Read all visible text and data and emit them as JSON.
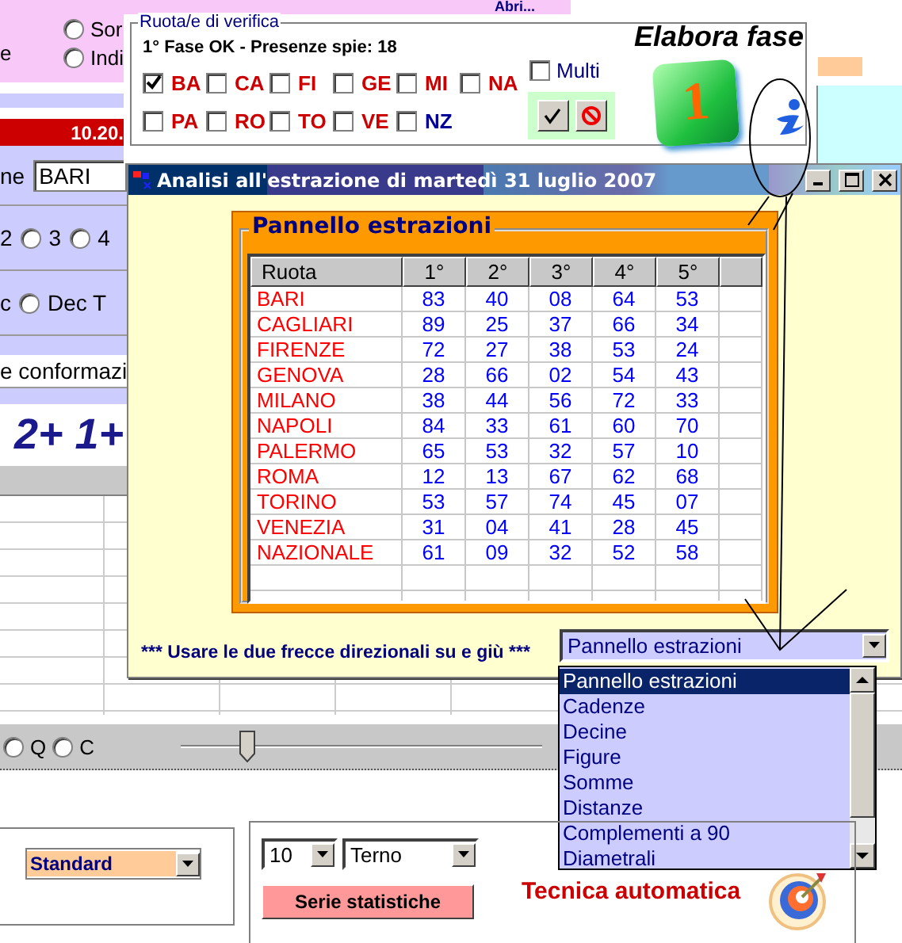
{
  "background_app": {
    "link_text": "Abri...",
    "side_label": "e",
    "top_radios": [
      {
        "label": "Sor",
        "selected": false
      },
      {
        "label": "Indi",
        "selected": false
      }
    ],
    "time_label": "10.20.",
    "wheel_label": "ne",
    "wheel_value": "BARI",
    "count_prefix": "2",
    "count_radios": [
      {
        "label": "3",
        "selected": false
      },
      {
        "label": "4",
        "selected": false
      }
    ],
    "dec_label": "c",
    "dec_radios": [
      {
        "label": "Dec T",
        "selected": false
      }
    ],
    "conformation_text": "e conformazi",
    "formula": "2+ 1+",
    "filter_radios": [
      {
        "label": "Q",
        "selected": false
      },
      {
        "label": "C",
        "selected": false
      }
    ],
    "slider": {
      "level": 0.17
    },
    "mode_select": "Standard"
  },
  "verifica": {
    "legend": "Ruota/e di verifica",
    "status": "1° Fase OK - Presenze spie: 18",
    "title": "Elabora fase",
    "phase_number": "1",
    "wheels": [
      {
        "label": "BA",
        "checked": true,
        "color": "#cc0000"
      },
      {
        "label": "CA",
        "checked": false,
        "color": "#cc0000"
      },
      {
        "label": "FI",
        "checked": false,
        "color": "#cc0000"
      },
      {
        "label": "GE",
        "checked": false,
        "color": "#cc0000"
      },
      {
        "label": "MI",
        "checked": false,
        "color": "#cc0000"
      },
      {
        "label": "NA",
        "checked": false,
        "color": "#cc0000"
      },
      {
        "label": "PA",
        "checked": false,
        "color": "#cc0000"
      },
      {
        "label": "RO",
        "checked": false,
        "color": "#cc0000"
      },
      {
        "label": "TO",
        "checked": false,
        "color": "#cc0000"
      },
      {
        "label": "VE",
        "checked": false,
        "color": "#cc0000"
      },
      {
        "label": "NZ",
        "checked": false,
        "color": "#000099"
      }
    ],
    "multi": {
      "label": "Multi",
      "checked": false
    }
  },
  "window": {
    "title": "Analisi all'estrazione di martedì 31 luglio 2007",
    "panel_title": "Pannello estrazioni",
    "table": {
      "columns": [
        "Ruota",
        "1°",
        "2°",
        "3°",
        "4°",
        "5°"
      ],
      "rows": [
        {
          "ruota": "BARI",
          "numbers": [
            "83",
            "40",
            "08",
            "64",
            "53"
          ]
        },
        {
          "ruota": "CAGLIARI",
          "numbers": [
            "89",
            "25",
            "37",
            "66",
            "34"
          ]
        },
        {
          "ruota": "FIRENZE",
          "numbers": [
            "72",
            "27",
            "38",
            "53",
            "24"
          ]
        },
        {
          "ruota": "GENOVA",
          "numbers": [
            "28",
            "66",
            "02",
            "54",
            "43"
          ]
        },
        {
          "ruota": "MILANO",
          "numbers": [
            "38",
            "44",
            "56",
            "72",
            "33"
          ]
        },
        {
          "ruota": "NAPOLI",
          "numbers": [
            "84",
            "33",
            "61",
            "60",
            "70"
          ]
        },
        {
          "ruota": "PALERMO",
          "numbers": [
            "65",
            "53",
            "32",
            "57",
            "10"
          ]
        },
        {
          "ruota": "ROMA",
          "numbers": [
            "12",
            "13",
            "67",
            "62",
            "68"
          ]
        },
        {
          "ruota": "TORINO",
          "numbers": [
            "53",
            "57",
            "74",
            "45",
            "07"
          ]
        },
        {
          "ruota": "VENEZIA",
          "numbers": [
            "31",
            "04",
            "41",
            "28",
            "45"
          ]
        },
        {
          "ruota": "NAZIONALE",
          "numbers": [
            "61",
            "09",
            "32",
            "52",
            "58"
          ]
        }
      ]
    },
    "hint": "*** Usare le due frecce direzionali su e giù ***",
    "view_select": "Pannello estrazioni",
    "view_options": [
      {
        "label": "Pannello estrazioni",
        "selected": true
      },
      {
        "label": "Cadenze",
        "selected": false
      },
      {
        "label": "Decine",
        "selected": false
      },
      {
        "label": "Figure",
        "selected": false
      },
      {
        "label": "Somme",
        "selected": false
      },
      {
        "label": "Distanze",
        "selected": false
      },
      {
        "label": "Complementi a 90",
        "selected": false
      },
      {
        "label": "Diametrali",
        "selected": false
      }
    ]
  },
  "bottom_panel": {
    "count_select": "10",
    "type_select": "Terno",
    "button": "Serie statistiche",
    "technique_label": "Tecnica automatica"
  }
}
